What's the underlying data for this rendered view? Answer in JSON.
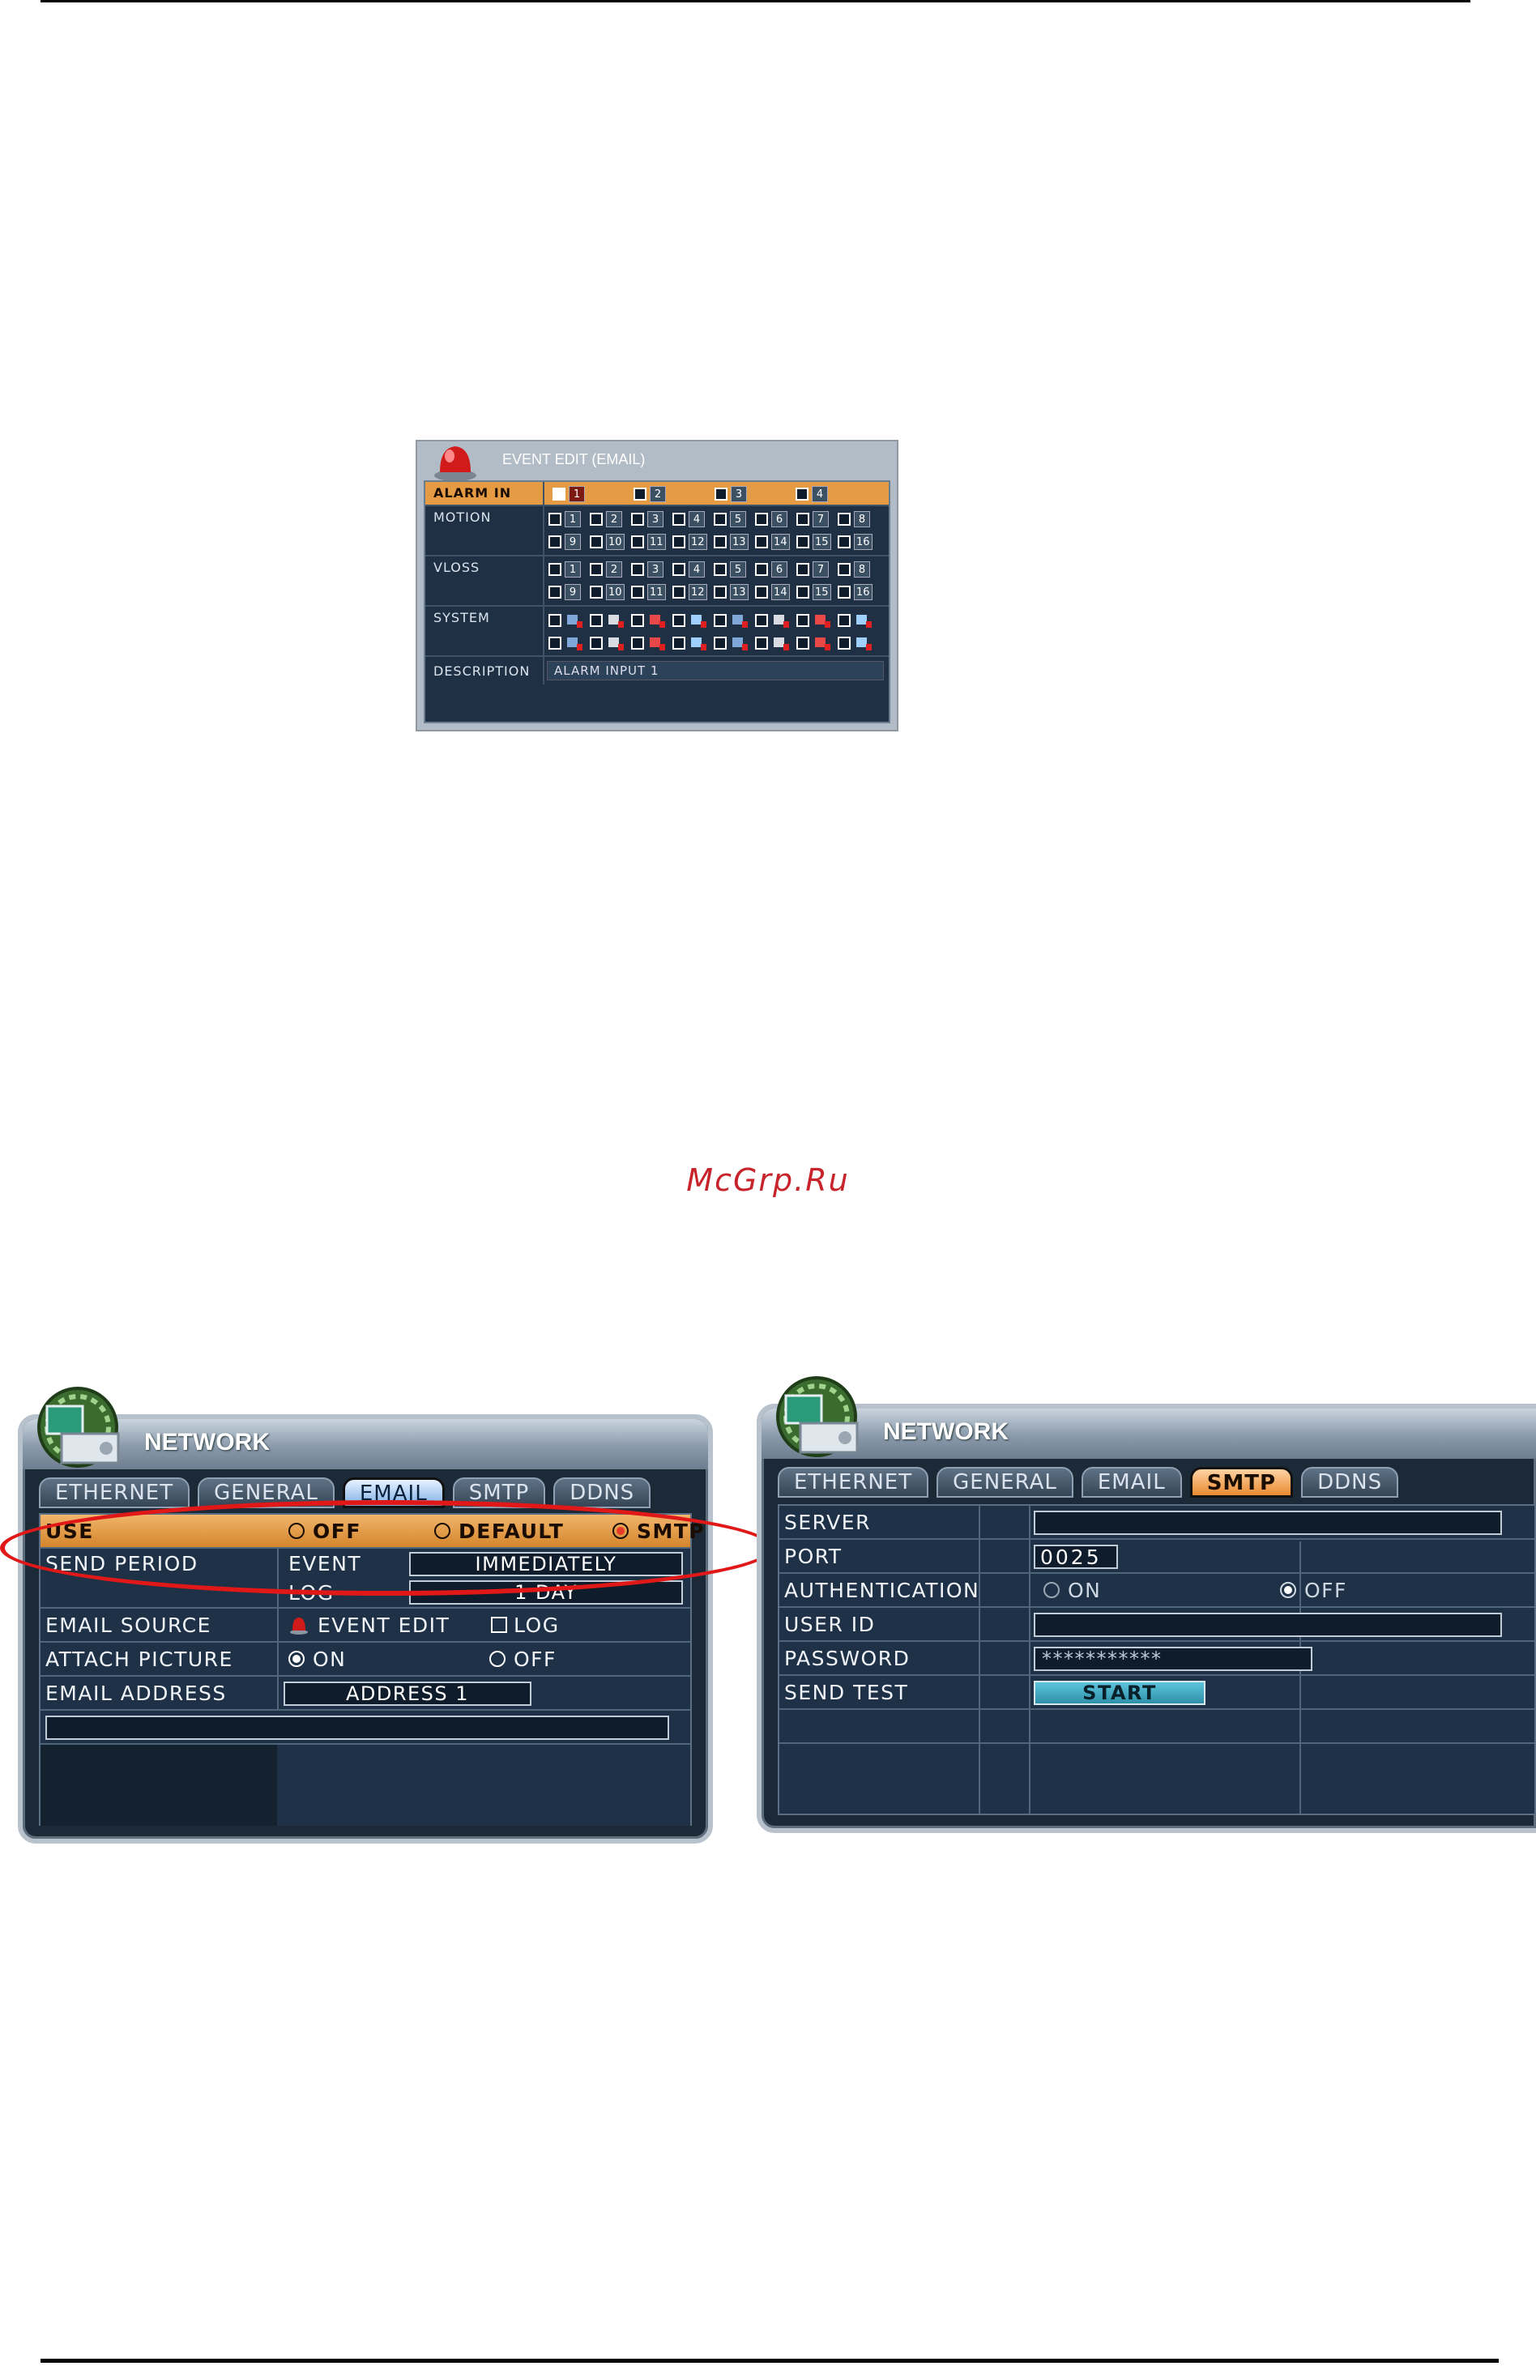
{
  "watermark": "McGrp.Ru",
  "event_edit": {
    "title": "EVENT EDIT (EMAIL)",
    "rows": {
      "alarm_in": "ALARM IN",
      "motion": "MOTION",
      "vloss": "VLOSS",
      "system": "SYSTEM",
      "description": "DESCRIPTION"
    },
    "alarm_inputs": [
      "1",
      "2",
      "3",
      "4"
    ],
    "channels_row1": [
      "1",
      "2",
      "3",
      "4",
      "5",
      "6",
      "7",
      "8"
    ],
    "channels_row2": [
      "9",
      "10",
      "11",
      "12",
      "13",
      "14",
      "15",
      "16"
    ],
    "description_value": "ALARM INPUT 1",
    "colors": {
      "highlight": "#e59a44",
      "panel": "#1f3045"
    }
  },
  "email_panel": {
    "title": "NETWORK",
    "tabs": [
      "ETHERNET",
      "GENERAL",
      "EMAIL",
      "SMTP",
      "DDNS"
    ],
    "active_tab": "EMAIL",
    "use": {
      "label": "USE",
      "options": [
        "OFF",
        "DEFAULT",
        "SMTP"
      ],
      "selected": "SMTP"
    },
    "send_period": {
      "label": "SEND PERIOD",
      "event_label": "EVENT",
      "event_value": "IMMEDIATELY",
      "log_label": "LOG",
      "log_value": "1 DAY"
    },
    "email_source": {
      "label": "EMAIL SOURCE",
      "event_edit": "EVENT EDIT",
      "log": "LOG"
    },
    "attach_picture": {
      "label": "ATTACH PICTURE",
      "on": "ON",
      "off": "OFF",
      "selected": "ON"
    },
    "email_address": {
      "label": "EMAIL ADDRESS",
      "value": "ADDRESS 1"
    }
  },
  "smtp_panel": {
    "title": "NETWORK",
    "tabs": [
      "ETHERNET",
      "GENERAL",
      "EMAIL",
      "SMTP",
      "DDNS"
    ],
    "active_tab": "SMTP",
    "server": {
      "label": "SERVER",
      "value": ""
    },
    "port": {
      "label": "PORT",
      "value": "0025"
    },
    "authentication": {
      "label": "AUTHENTICATION",
      "on": "ON",
      "off": "OFF",
      "selected": "OFF"
    },
    "user_id": {
      "label": "USER ID",
      "value": ""
    },
    "password": {
      "label": "PASSWORD",
      "value": "***********"
    },
    "send_test": {
      "label": "SEND TEST",
      "button": "START"
    }
  },
  "colors": {
    "annotation_ellipse": "#e01818",
    "watermark": "#c8232a",
    "active_orange": "#ea8a2f",
    "active_blue": "#7fb1e6",
    "start_button": "#3aa0b8"
  }
}
